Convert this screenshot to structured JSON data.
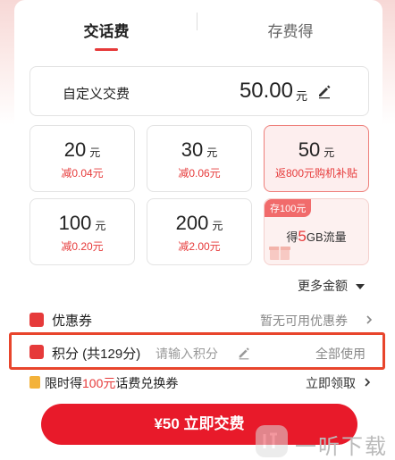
{
  "tabs": [
    {
      "label": "交话费",
      "active": true
    },
    {
      "label": "存费得",
      "active": false
    }
  ],
  "custom": {
    "label": "自定义交费",
    "value": "50.00",
    "unit": "元"
  },
  "amounts": [
    {
      "value": "20",
      "unit": "元",
      "sub": "减0.04元"
    },
    {
      "value": "30",
      "unit": "元",
      "sub": "减0.06元"
    },
    {
      "value": "50",
      "unit": "元",
      "sub": "返800元购机补贴",
      "selected": true
    },
    {
      "value": "100",
      "unit": "元",
      "sub": "减0.20元"
    },
    {
      "value": "200",
      "unit": "元",
      "sub": "减2.00元"
    }
  ],
  "traffic_card": {
    "badge": "存100元",
    "prefix": "得",
    "amount": "5",
    "suffix": "GB流量"
  },
  "more_label": "更多金额",
  "coupon": {
    "label": "优惠券",
    "right": "暂无可用优惠券"
  },
  "points": {
    "label": "积分 (共129分)",
    "placeholder": "请输入积分",
    "right": "全部使用"
  },
  "promo": {
    "prefix": "限时得",
    "highlight": "100元",
    "suffix": "话费兑换券",
    "right": "立即领取"
  },
  "pay_button": "¥50 立即交费",
  "watermark": "一听下载",
  "colors": {
    "accent": "#e81a2a",
    "highlight": "#e8452c"
  }
}
